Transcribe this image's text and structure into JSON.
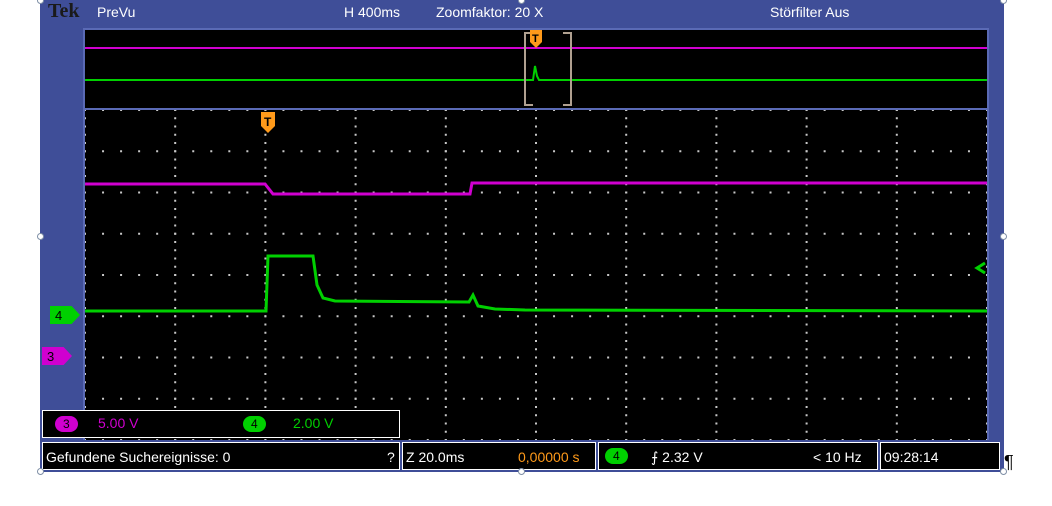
{
  "header": {
    "brand": "Tek",
    "mode": "PreVu",
    "horizontal": "H 400ms",
    "zoom": "Zoomfaktor: 20 X",
    "filter": "Störfilter Aus"
  },
  "channels": {
    "ch3": {
      "id": "3",
      "scale": "5.00 V",
      "color": "#d000d0"
    },
    "ch4": {
      "id": "4",
      "scale": "2.00 V",
      "color": "#00d000"
    }
  },
  "trigger_marker": "T",
  "status": {
    "search_label": "Gefundene Suchereignisse: 0",
    "help": "?",
    "zoom_time": "Z 20.0ms",
    "position": "0,00000 s",
    "trigger_channel": "4",
    "trigger_level": "⨍ 2.32 V",
    "frequency": "< 10 Hz",
    "time": "09:28:14"
  },
  "paragraph_mark": "¶",
  "colors": {
    "accent": "#3f4e98",
    "trigger": "#ff9a1a",
    "ch3": "#d000d0",
    "ch4": "#00d000"
  }
}
